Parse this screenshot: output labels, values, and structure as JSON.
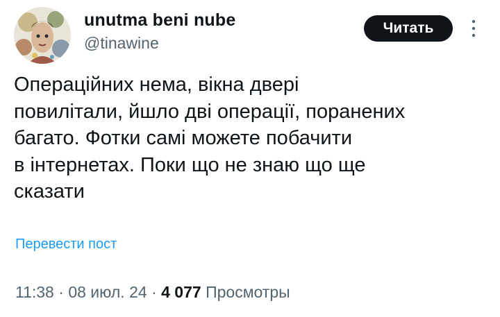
{
  "author": {
    "display_name": "unutma beni nube",
    "handle": "@tinawine",
    "avatar": "avatar-illustration"
  },
  "follow_button": {
    "label": "Читать"
  },
  "more_icon": "more-vertical-icon",
  "tweet": {
    "text": "Операційних нема, вікна двері\nповилітали, йшло дві операції, поранених\nбагато. Фотки самі можете побачити\nв інтернетах. Поки що не знаю що ще\nсказати",
    "translate_label": "Перевести пост"
  },
  "meta": {
    "time": "11:38",
    "separator": "·",
    "date": "08 июл. 24",
    "views_count": "4 077",
    "views_label": "Просмотры"
  },
  "colors": {
    "link": "#1d9bf0",
    "secondary_text": "#536471",
    "primary_text": "#0f1419",
    "button_bg": "#0f1419"
  }
}
